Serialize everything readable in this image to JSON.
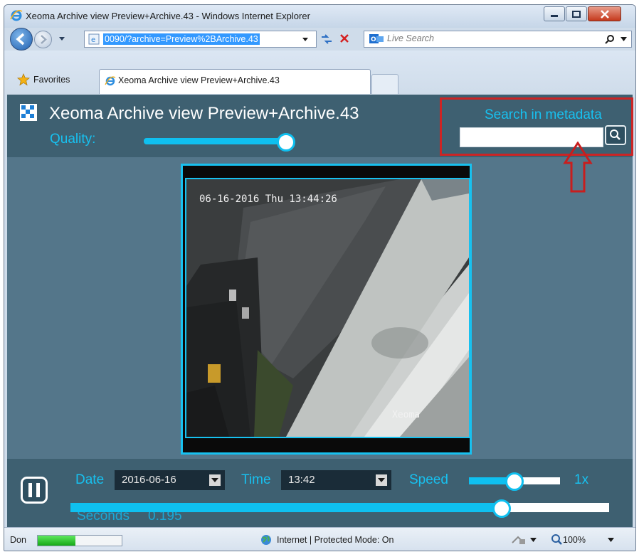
{
  "browser": {
    "window_title": "Xeoma Archive view Preview+Archive.43 - Windows Internet Explorer",
    "address": "0090/?archive=Preview%2BArchive.43",
    "search_placeholder": "Live Search",
    "favorites_label": "Favorites",
    "tab_title": "Xeoma Archive view Preview+Archive.43",
    "status_text": "Don",
    "zone_text": "Internet | Protected Mode: On",
    "zoom": "100%",
    "load_progress": 0.45
  },
  "app": {
    "title": "Xeoma Archive view Preview+Archive.43",
    "quality_label": "Quality:",
    "quality_value": 1.0,
    "search_label": "Search in metadata",
    "search_value": ""
  },
  "video": {
    "timestamp": "06-16-2016 Thu 13:44:26",
    "watermark": "Xeoma"
  },
  "controls": {
    "date_label": "Date",
    "date_value": "2016-06-16",
    "time_label": "Time",
    "time_value": "13:42",
    "speed_label": "Speed",
    "speed_value_text": "1x",
    "speed_position": 0.5,
    "seconds_label": "Seconds",
    "seconds_value": "0.195",
    "seconds_position": 0.8
  },
  "colors": {
    "accent": "#17c1f0",
    "panel": "#3e6071",
    "background": "#54768a",
    "highlight_box": "#cc2424"
  }
}
